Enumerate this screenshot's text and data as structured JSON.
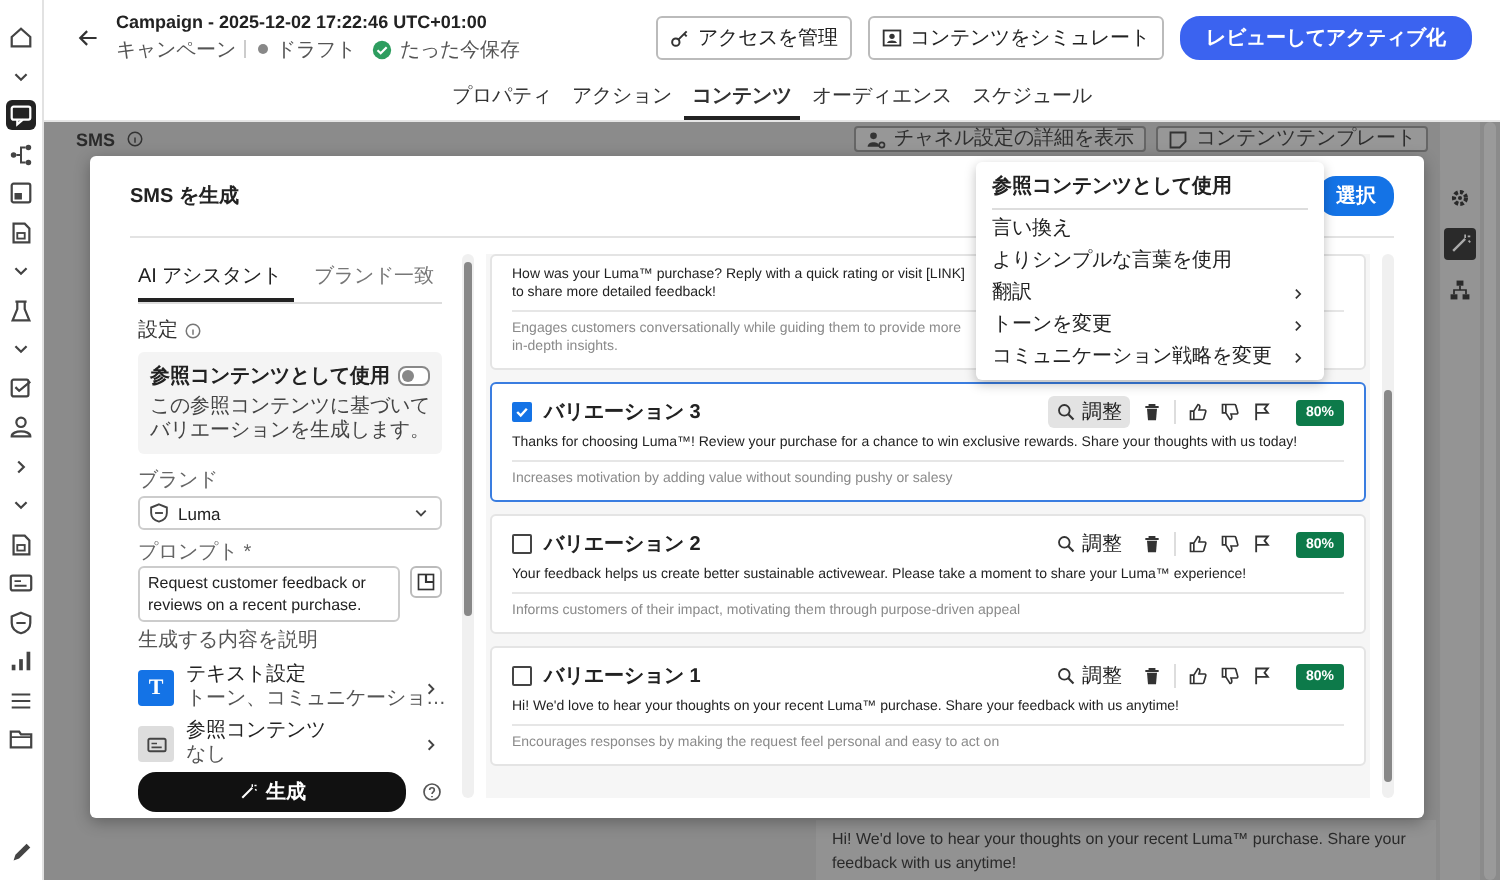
{
  "nav": [
    {
      "kind": "home",
      "selected": false
    },
    {
      "kind": "chevron-down",
      "selected": false
    },
    {
      "kind": "chat",
      "selected": true
    },
    {
      "kind": "branch",
      "selected": false
    },
    {
      "kind": "layout",
      "selected": false
    },
    {
      "kind": "document",
      "selected": false
    },
    {
      "kind": "chevron-down",
      "selected": false
    },
    {
      "kind": "flask",
      "selected": false
    },
    {
      "kind": "chevron-down",
      "selected": false
    },
    {
      "kind": "checklist",
      "selected": false
    },
    {
      "kind": "user",
      "selected": false
    },
    {
      "kind": "chevron-right",
      "selected": false
    },
    {
      "kind": "chevron-down",
      "selected": false
    },
    {
      "kind": "document",
      "selected": false
    },
    {
      "kind": "card",
      "selected": false
    },
    {
      "kind": "shield",
      "selected": false
    },
    {
      "kind": "chart",
      "selected": false
    },
    {
      "kind": "list",
      "selected": false
    },
    {
      "kind": "folder",
      "selected": false
    },
    {
      "kind": "pencil",
      "selected": false
    }
  ],
  "header": {
    "title": "Campaign - 2025-12-02 17:22:46 UTC+01:00",
    "breadcrumb": "キャンペーン",
    "status": "ドラフト",
    "save_state": "たった今保存",
    "buttons": [
      {
        "label": "アクセスを管理",
        "kind": "access"
      },
      {
        "label": "コンテンツをシミュレート",
        "kind": "simulate"
      },
      {
        "label": "レビューしてアクティブ化",
        "kind": "primary"
      }
    ]
  },
  "tabs": [
    {
      "label": "プロパティ",
      "selected": false
    },
    {
      "label": "アクション",
      "selected": false
    },
    {
      "label": "コンテンツ",
      "selected": true
    },
    {
      "label": "オーディエンス",
      "selected": false
    },
    {
      "label": "スケジュール",
      "selected": false
    }
  ],
  "content": {
    "title": "SMS",
    "buttons": [
      {
        "label": "チャネル設定の詳細を表示",
        "kind": "channel"
      },
      {
        "label": "コンテンツテンプレート",
        "kind": "template"
      }
    ],
    "preview_text": "Hi! We'd love to hear your thoughts on your recent Luma™ purchase. Share your feedback with us anytime!",
    "tools": [
      {
        "kind": "gear",
        "selected": false
      },
      {
        "kind": "wand",
        "selected": true
      },
      {
        "kind": "hierarchy",
        "selected": false
      }
    ]
  },
  "modal": {
    "title": "SMS を生成",
    "select_button": "選択",
    "assistant": {
      "tabs": [
        {
          "label": "AI アシスタント",
          "selected": true
        },
        {
          "label": "ブランド一致",
          "selected": false
        }
      ],
      "settings_label": "設定",
      "reference": {
        "title": "参照コンテンツとして使用",
        "on": false,
        "description": "この参照コンテンツに基づいてバリエーションを生成します。"
      },
      "brand_label": "ブランド",
      "brand": "Luma",
      "prompt_label": "プロンプト *",
      "prompt": "Request customer feedback or reviews on a recent purchase.",
      "prompt_hint": "生成する内容を説明",
      "options": [
        {
          "kind": "text",
          "icon_letter": "T",
          "title": "テキスト設定",
          "value": "トーン、コミュニケーショ…"
        },
        {
          "kind": "reference",
          "title": "参照コンテンツ",
          "value": "なし"
        }
      ],
      "generate_button": "生成"
    },
    "variations": [
      {
        "kind": "partial",
        "text": "How was your Luma™ purchase? Reply with a quick rating or visit [LINK] to share more detailed feedback!",
        "reason": "Engages customers conversationally while guiding them to provide more in-depth insights."
      },
      {
        "kind": "variation",
        "title": "バリエーション 3",
        "checked": true,
        "selected": true,
        "text": "Thanks for choosing Luma™! Review your purchase for a chance to win exclusive rewards. Share your thoughts with us today!",
        "reason": "Increases motivation by adding value without sounding pushy or salesy",
        "adjust_label": "調整",
        "adjust_hovered": true,
        "score": "80%"
      },
      {
        "kind": "variation",
        "title": "バリエーション 2",
        "checked": false,
        "selected": false,
        "text": "Your feedback helps us create better sustainable activewear. Please take a moment to share your Luma™ experience!",
        "reason": "Informs customers of their impact, motivating them through purpose-driven appeal",
        "adjust_label": "調整",
        "adjust_hovered": false,
        "score": "80%"
      },
      {
        "kind": "variation",
        "title": "バリエーション 1",
        "checked": false,
        "selected": false,
        "text": "Hi! We'd love to hear your thoughts on your recent Luma™ purchase. Share your feedback with us anytime!",
        "reason": "Encourages responses by making the request feel personal and easy to act on",
        "adjust_label": "調整",
        "adjust_hovered": false,
        "score": "80%"
      }
    ]
  },
  "menu": {
    "header": "参照コンテンツとして使用",
    "items": [
      {
        "label": "言い換え",
        "submenu": false
      },
      {
        "label": "よりシンプルな言葉を使用",
        "submenu": false
      },
      {
        "label": "翻訳",
        "submenu": true
      },
      {
        "label": "トーンを変更",
        "submenu": true
      },
      {
        "label": "コミュニケーション戦略を変更",
        "submenu": true
      }
    ]
  }
}
